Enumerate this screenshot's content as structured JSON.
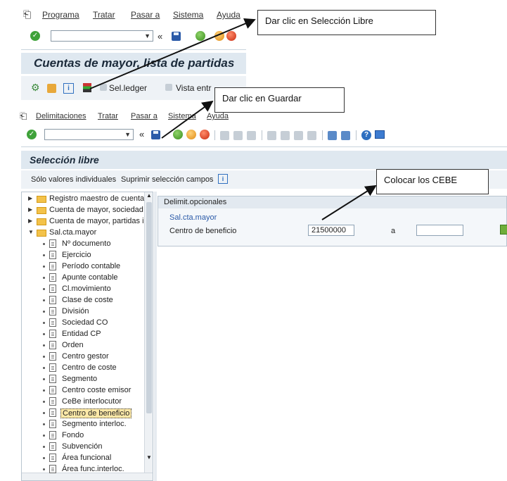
{
  "top_window": {
    "menu": [
      "Programa",
      "Tratar",
      "Pasar a",
      "Sistema",
      "Ayuda"
    ],
    "title": "Cuentas de mayor, lista de partidas",
    "toolbar_items": [
      "Sel.ledger",
      "Vista entr"
    ]
  },
  "bottom_window": {
    "menu": [
      "Delimitaciones",
      "Tratar",
      "Pasar a",
      "Sistema",
      "Ayuda"
    ],
    "title": "Selección libre",
    "app_toolbar": [
      "Sólo valores individuales",
      "Suprimir selección campos"
    ],
    "tree": {
      "folders": [
        "Registro maestro de cuenta",
        "Cuenta de mayor, sociedad",
        "Cuenta de mayor, partidas i",
        "Sal.cta.mayor"
      ],
      "fields": [
        "Nº documento",
        "Ejercicio",
        "Período contable",
        "Apunte contable",
        "Cl.movimiento",
        "Clase de coste",
        "División",
        "Sociedad CO",
        "Entidad CP",
        "Orden",
        "Centro gestor",
        "Centro de coste",
        "Segmento",
        "Centro coste emisor",
        "CeBe interlocutor",
        "Centro de beneficio",
        "Segmento interloc.",
        "Fondo",
        "Subvención",
        "Área funcional",
        "Área func.interloc."
      ],
      "selected": "Centro de beneficio"
    },
    "panel": {
      "header": "Delimit.opcionales",
      "group": "Sal.cta.mayor",
      "field_label": "Centro de beneficio",
      "from_value": "21500000",
      "to_label": "a",
      "to_value": ""
    }
  },
  "annotations": {
    "note1": "Dar clic en Selección Libre",
    "note2": "Dar clic en Guardar",
    "note3": "Colocar los CEBE"
  }
}
